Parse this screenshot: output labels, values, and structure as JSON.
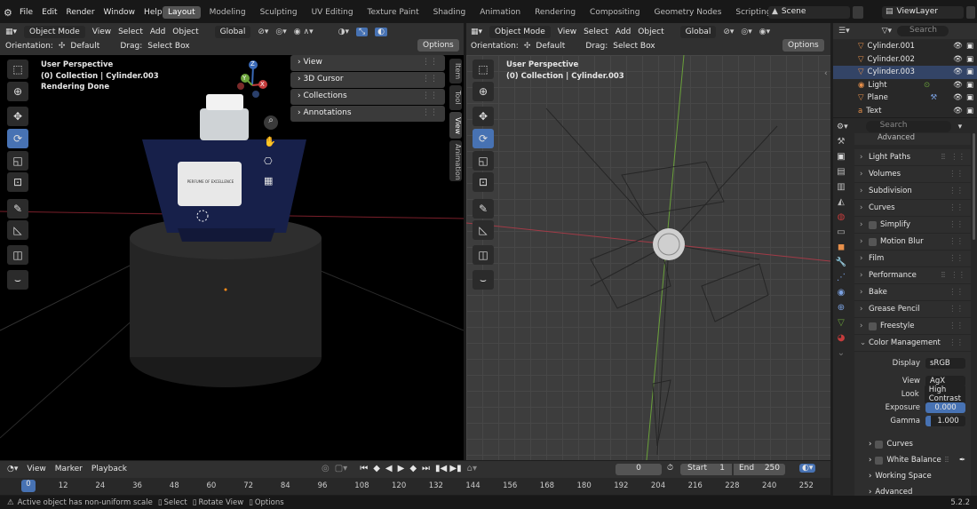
{
  "topbar": {
    "menus": [
      "File",
      "Edit",
      "Render",
      "Window",
      "Help"
    ],
    "workspaces": [
      "Layout",
      "Modeling",
      "Sculpting",
      "UV Editing",
      "Texture Paint",
      "Shading",
      "Animation",
      "Rendering",
      "Compositing",
      "Geometry Nodes",
      "Scripting"
    ],
    "add_tab": "+",
    "scene": "Scene",
    "view_layer": "ViewLayer"
  },
  "left_viewport": {
    "mode": "Object Mode",
    "menus": [
      "View",
      "Select",
      "Add",
      "Object"
    ],
    "transform": "Global",
    "orientation_label": "Orientation:",
    "orientation_value": "Default",
    "drag_label": "Drag:",
    "drag_value": "Select Box",
    "options": "Options",
    "info": [
      "User Perspective",
      "(0) Collection | Cylinder.003",
      "Rendering Done"
    ],
    "npanel": [
      "View",
      "3D Cursor",
      "Collections",
      "Annotations"
    ],
    "vtabs": [
      "Item",
      "Tool",
      "View",
      "Animation"
    ],
    "label_text": "PERFUME OF EXCELLENCE",
    "gizmo": {
      "x": "X",
      "y": "Y",
      "z": "Z"
    }
  },
  "right_viewport": {
    "mode": "Object Mode",
    "menus": [
      "View",
      "Select",
      "Add",
      "Object"
    ],
    "transform": "Global",
    "orientation_label": "Orientation:",
    "orientation_value": "Default",
    "drag_label": "Drag:",
    "drag_value": "Select Box",
    "options": "Options",
    "info": [
      "User Perspective",
      "(0) Collection | Cylinder.003"
    ]
  },
  "outliner": {
    "search_placeholder": "Search",
    "items": [
      {
        "name": "Cylinder.001",
        "color": "#e8904a"
      },
      {
        "name": "Cylinder.002",
        "color": "#e8904a"
      },
      {
        "name": "Cylinder.003",
        "color": "#e8904a"
      },
      {
        "name": "Light",
        "color": "#e8904a"
      },
      {
        "name": "Plane",
        "color": "#e8904a"
      },
      {
        "name": "Text",
        "color": "#e8904a"
      }
    ]
  },
  "properties": {
    "search_placeholder": "Search",
    "top_cut": "Advanced",
    "panels": [
      "Light Paths",
      "Volumes",
      "Subdivision",
      "Curves",
      "Simplify",
      "Motion Blur",
      "Film",
      "Performance",
      "Bake",
      "Grease Pencil",
      "Freestyle"
    ],
    "color_management": {
      "title": "Color Management",
      "display_label": "Display",
      "display_value": "sRGB",
      "view_label": "View",
      "view_value": "AgX",
      "look_label": "Look",
      "look_value": "High Contrast",
      "exposure_label": "Exposure",
      "exposure_value": "0.000",
      "gamma_label": "Gamma",
      "gamma_value": "1.000",
      "sub": [
        "Curves",
        "White Balance",
        "Working Space",
        "Advanced"
      ]
    }
  },
  "timeline": {
    "menus": [
      "View",
      "Marker",
      "Playback"
    ],
    "current_frame": "0",
    "start_label": "Start",
    "start": "1",
    "end_label": "End",
    "end": "250",
    "ticks": [
      "0",
      "12",
      "24",
      "36",
      "48",
      "60",
      "72",
      "84",
      "96",
      "108",
      "120",
      "132",
      "144",
      "156",
      "168",
      "180",
      "192",
      "204",
      "216",
      "228",
      "240",
      "252"
    ]
  },
  "statusbar": {
    "message": "Active object has non-uniform scale",
    "hints": [
      "Select",
      "Rotate View",
      "Options"
    ],
    "version": "5.2.2"
  },
  "colors": {
    "accent": "#4772b3",
    "header": "#303030",
    "viewport_left": "#000000",
    "viewport_right": "#3d3d3d"
  }
}
